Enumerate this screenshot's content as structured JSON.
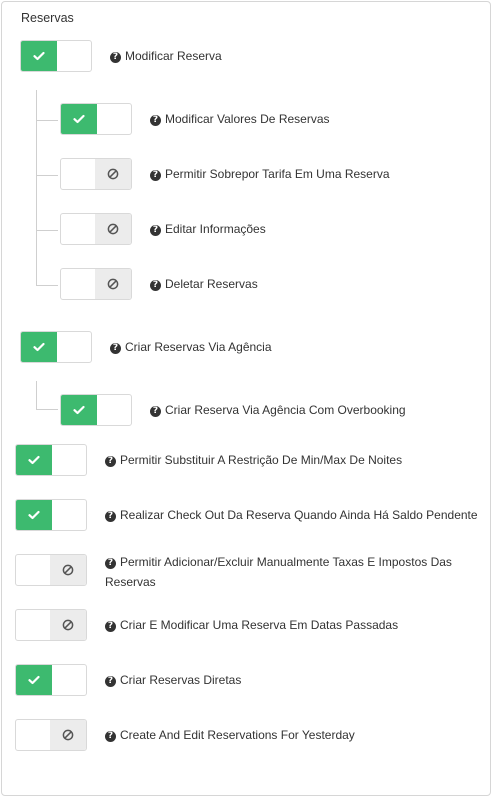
{
  "section": {
    "title": "Reservas"
  },
  "permissions": {
    "modificar_reserva": {
      "label": "Modificar Reserva",
      "enabled": true
    },
    "modificar_valores": {
      "label": "Modificar Valores De Reservas",
      "enabled": true
    },
    "sobrepor_tarifa": {
      "label": "Permitir Sobrepor Tarifa Em Uma Reserva",
      "enabled": false
    },
    "editar_informacoes": {
      "label": "Editar Informações",
      "enabled": false
    },
    "deletar_reservas": {
      "label": "Deletar Reservas",
      "enabled": false
    },
    "criar_via_agencia": {
      "label": "Criar Reservas Via Agência",
      "enabled": true
    },
    "criar_via_agencia_overbooking": {
      "label": "Criar Reserva Via Agência Com Overbooking",
      "enabled": true
    },
    "substituir_restricao": {
      "label": "Permitir Substituir A Restrição De Min/Max De Noites",
      "enabled": true
    },
    "checkout_saldo_pendente": {
      "label": "Realizar Check Out Da Reserva Quando Ainda Há Saldo Pendente",
      "enabled": true
    },
    "taxas_impostos": {
      "label": "Permitir Adicionar/Excluir Manualmente Taxas E Impostos Das Reservas",
      "enabled": false
    },
    "datas_passadas": {
      "label": "Criar E Modificar Uma Reserva Em Datas Passadas",
      "enabled": false
    },
    "reservas_diretas": {
      "label": "Criar Reservas Diretas",
      "enabled": true
    },
    "edit_yesterday": {
      "label": "Create And Edit Reservations For Yesterday",
      "enabled": false
    }
  },
  "icons": {
    "on": "check-icon",
    "off": "ban-icon",
    "help": "question-circle-icon"
  },
  "colors": {
    "on": "#3dba6f",
    "off": "#ececec"
  }
}
